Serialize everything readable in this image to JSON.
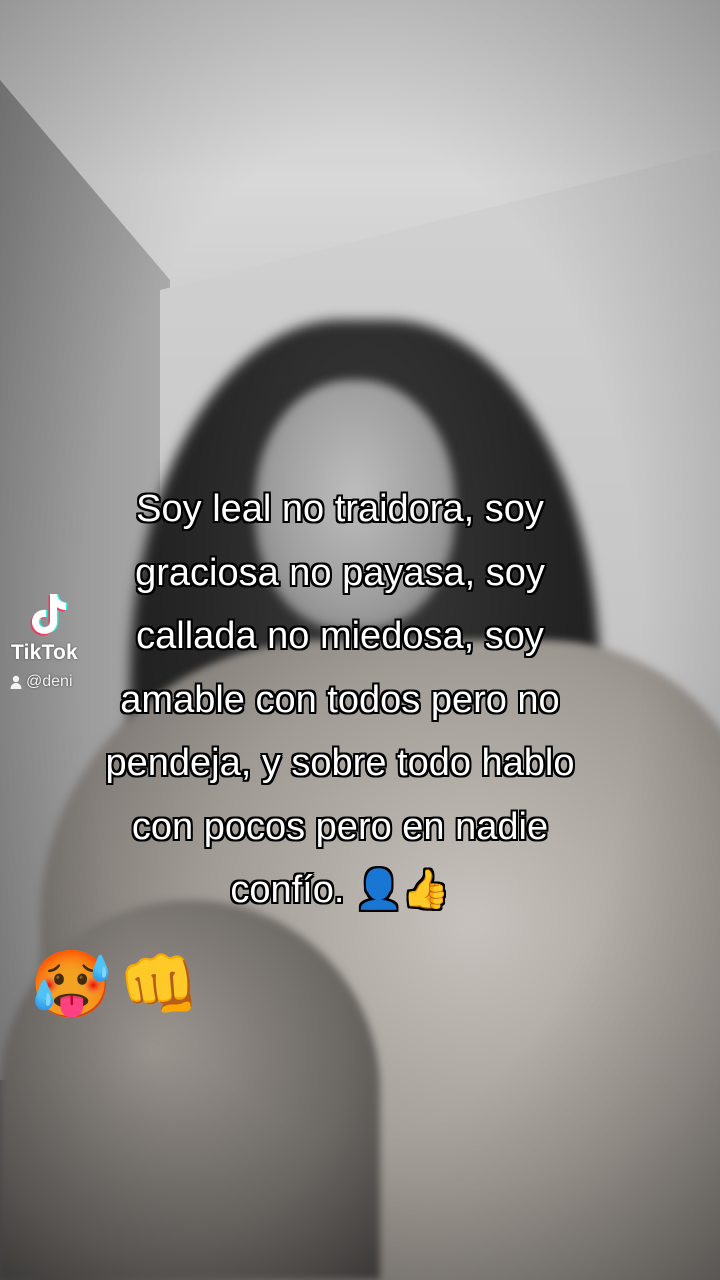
{
  "watermark": {
    "brand": "TikTok",
    "username": "@deni",
    "logo_icon": "tiktok-note-icon",
    "user_icon": "person-icon"
  },
  "caption": {
    "lines": [
      "Soy leal no traidora, soy",
      "graciosa no payasa, soy",
      "callada no miedosa, soy",
      "amable con todos pero no",
      "pendeja, y sobre todo hablo",
      "con pocos pero en nadie",
      "confío. 👤👍"
    ]
  },
  "reactions": {
    "emoji_1": "🥵",
    "emoji_2": "👊"
  }
}
